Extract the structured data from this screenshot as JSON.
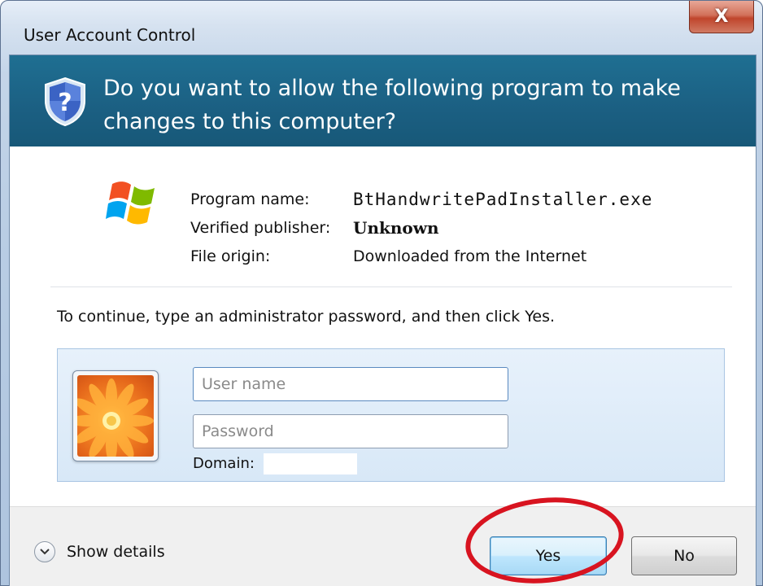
{
  "window": {
    "title": "User Account Control",
    "close_glyph": "X"
  },
  "banner": {
    "question": "Do you want to allow the following program to make changes to this computer?",
    "icon": "uac-shield-icon"
  },
  "program": {
    "icon": "windows-logo-icon",
    "name_label": "Program name:",
    "name_value": "BtHandwritePadInstaller.exe",
    "publisher_label": "Verified publisher:",
    "publisher_value": "Unknown",
    "origin_label": "File origin:",
    "origin_value": "Downloaded from the Internet"
  },
  "credentials": {
    "instruction": "To continue, type an administrator password, and then click Yes.",
    "avatar_icon": "user-avatar-flower-icon",
    "username_placeholder": "User name",
    "password_placeholder": "Password",
    "domain_label": "Domain:"
  },
  "footer": {
    "details_label": "Show details",
    "yes_label": "Yes",
    "no_label": "No"
  },
  "colors": {
    "banner": "#1b5f82",
    "highlight_circle": "#d81420"
  }
}
